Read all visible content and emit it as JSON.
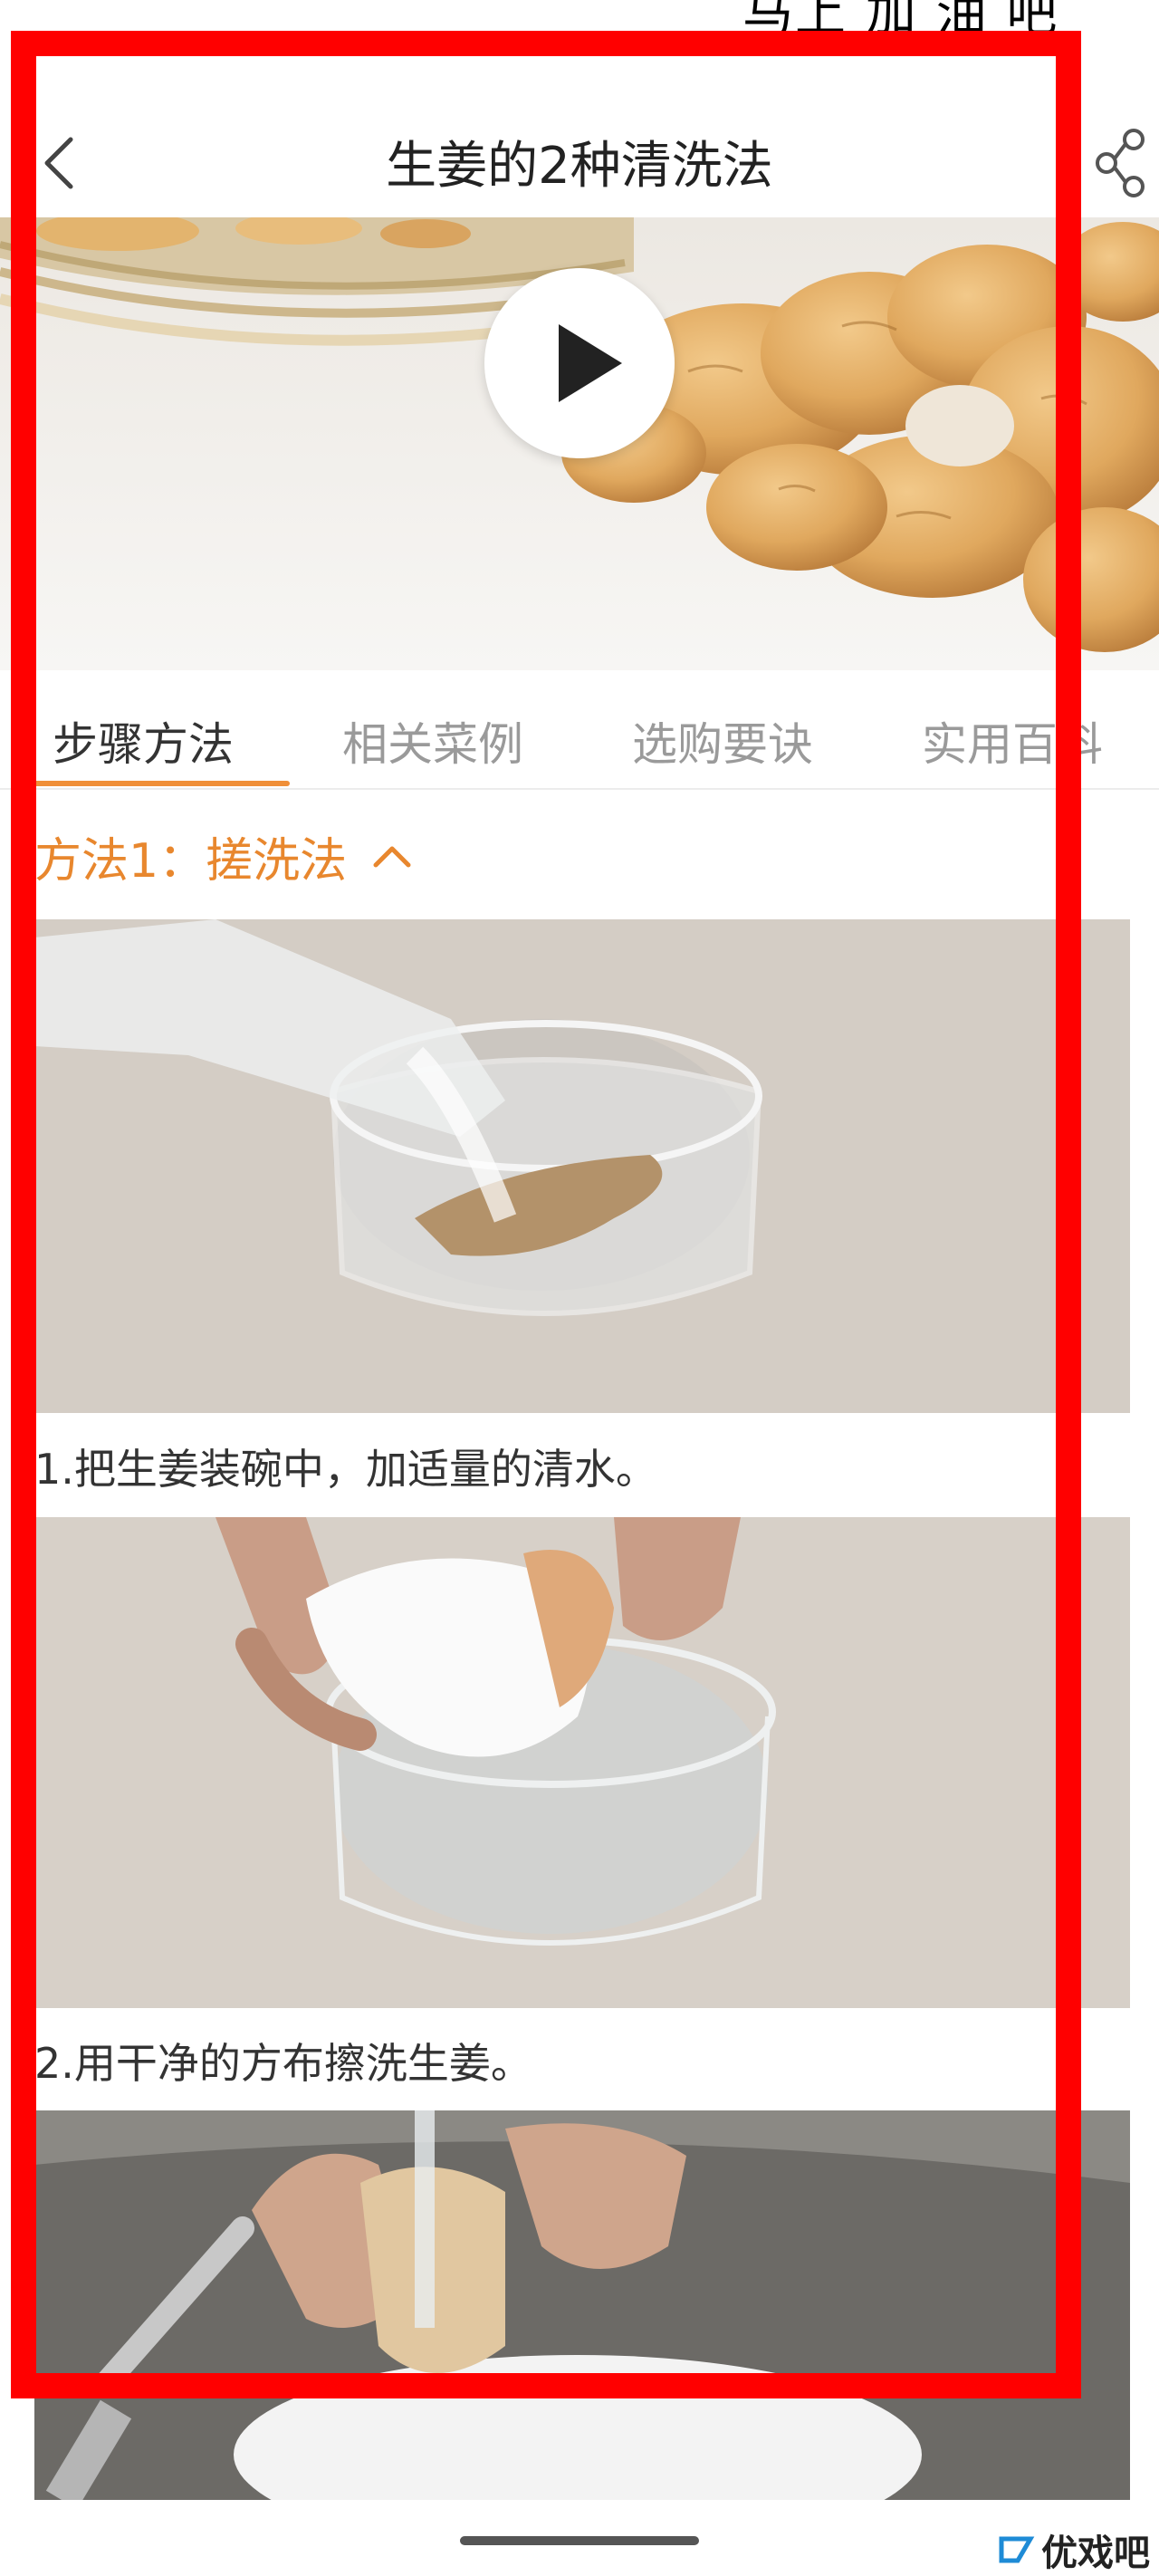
{
  "header": {
    "title": "生姜的2种清洗法",
    "back_icon": "chevron-left-icon",
    "share_icon": "share-icon"
  },
  "status_bar": {
    "text_fragment": "马上 加 油 吧"
  },
  "hero": {
    "play_icon": "play-icon"
  },
  "tabs": [
    {
      "label": "步骤方法",
      "active": true
    },
    {
      "label": "相关菜例",
      "active": false
    },
    {
      "label": "选购要诀",
      "active": false
    },
    {
      "label": "实用百科",
      "active": false
    }
  ],
  "method": {
    "title": "方法1：搓洗法",
    "toggle_icon": "chevron-up-icon"
  },
  "steps": [
    {
      "text": "1.把生姜装碗中，加适量的清水。"
    },
    {
      "text": "2.用干净的方布擦洗生姜。"
    }
  ],
  "watermark": {
    "text": "优戏吧"
  },
  "colors": {
    "accent": "#F08F38",
    "frame": "#FF0000"
  }
}
